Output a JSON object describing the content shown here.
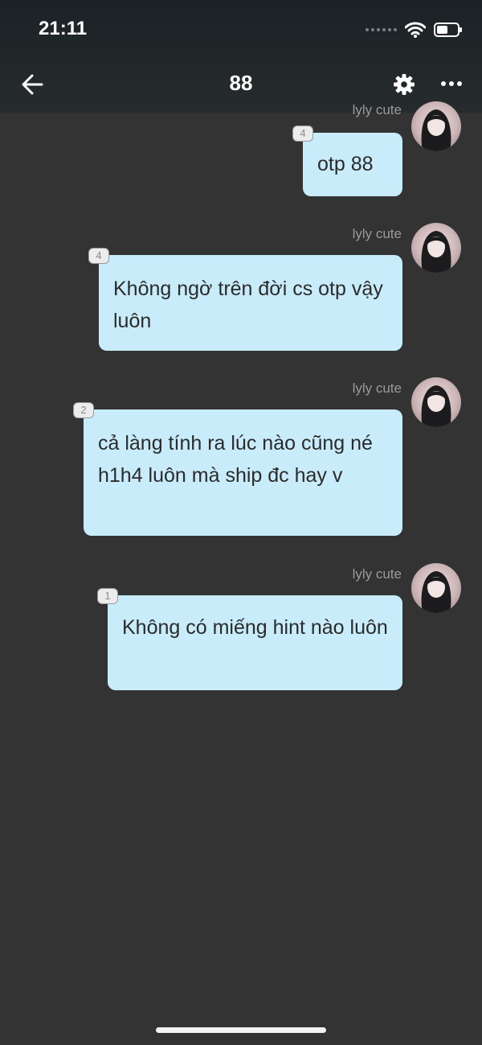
{
  "status_bar": {
    "time": "21:11"
  },
  "header": {
    "title": "88"
  },
  "faint_text": "",
  "messages": [
    {
      "sender": "lyly cute",
      "badge": "4",
      "text": "otp 88"
    },
    {
      "sender": "lyly cute",
      "badge": "4",
      "text": "Không ngờ trên đời cs otp vậy luôn"
    },
    {
      "sender": "lyly cute",
      "badge": "2",
      "text": "cả làng tính ra lúc nào cũng né h1h4 luôn mà ship đc hay v"
    },
    {
      "sender": "lyly cute",
      "badge": "1",
      "text": "Không có miếng hint nào luôn"
    }
  ],
  "colors": {
    "background": "#333333",
    "bubble": "#c9ecfa",
    "header": "#1f2628"
  },
  "icons": [
    "back-arrow-icon",
    "gear-icon",
    "more-dots-icon",
    "wifi-icon",
    "battery-icon"
  ]
}
